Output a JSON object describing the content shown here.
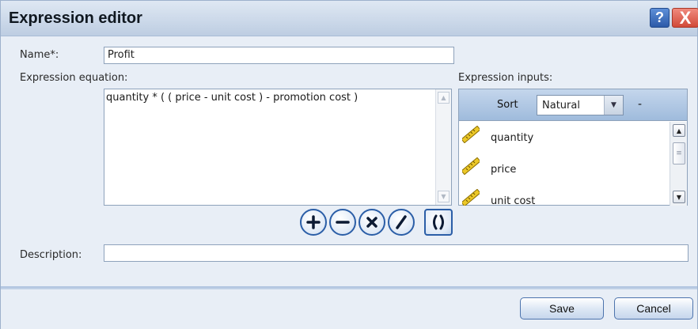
{
  "dialog": {
    "title": "Expression editor",
    "help_label": "?",
    "close_label": "X"
  },
  "form": {
    "name_label": "Name*:",
    "name_value": "Profit",
    "equation_label": "Expression equation:",
    "equation_value": "quantity * ( ( price - unit cost ) - promotion cost )",
    "inputs_label": "Expression inputs:",
    "description_label": "Description:",
    "description_value": ""
  },
  "inputs_panel": {
    "sort_label": "Sort",
    "sort_value": "Natural",
    "sort_dash": "-",
    "items": [
      {
        "label": "quantity",
        "icon": "ruler-icon"
      },
      {
        "label": "price",
        "icon": "ruler-icon"
      },
      {
        "label": "unit cost",
        "icon": "ruler-icon"
      }
    ]
  },
  "operators": [
    {
      "symbol": "+",
      "name": "plus"
    },
    {
      "symbol": "−",
      "name": "minus"
    },
    {
      "symbol": "×",
      "name": "multiply"
    },
    {
      "symbol": "/",
      "name": "divide"
    },
    {
      "symbol": "()",
      "name": "parentheses"
    }
  ],
  "footer": {
    "save_label": "Save",
    "cancel_label": "Cancel"
  },
  "colors": {
    "accent": "#2b5ea7",
    "title_bar": "#c9d7ea",
    "background": "#e8eef6",
    "ruler": "#e6c21a"
  }
}
